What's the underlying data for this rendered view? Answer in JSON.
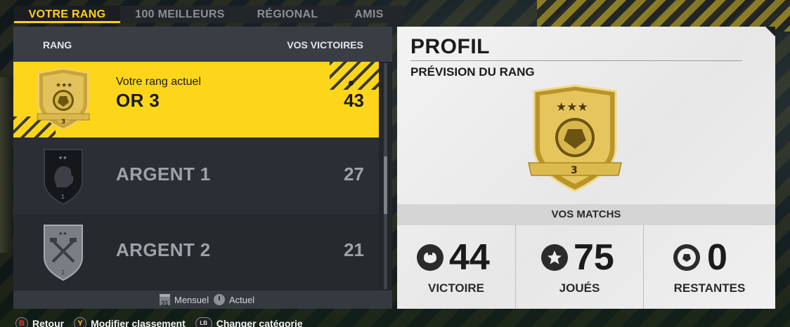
{
  "tabs": [
    {
      "label": "VOTRE RANG",
      "active": true
    },
    {
      "label": "100 MEILLEURS",
      "active": false
    },
    {
      "label": "RÉGIONAL",
      "active": false
    },
    {
      "label": "AMIS",
      "active": false
    }
  ],
  "rank_list": {
    "header_rank": "RANG",
    "header_wins": "VOS VICTOIRES",
    "rows": [
      {
        "subtitle": "Votre rang actuel",
        "name": "OR 3",
        "wins": "43",
        "badge_number": "3",
        "badge": "gold-rank-badge-icon",
        "current": true
      },
      {
        "subtitle": "",
        "name": "ARGENT 1",
        "wins": "27",
        "badge_number": "1",
        "badge": "dark-lion-badge-icon",
        "current": false
      },
      {
        "subtitle": "",
        "name": "ARGENT 2",
        "wins": "21",
        "badge_number": "2",
        "badge": "silver-hammer-badge-icon",
        "current": false
      }
    ],
    "footer": {
      "monthly": "Mensuel",
      "monthly_icon_text": "31",
      "current": "Actuel"
    }
  },
  "profile": {
    "title": "PROFIL",
    "subtitle": "PRÉVISION DU RANG",
    "badge_number": "3",
    "matches_title": "VOS MATCHS",
    "stats": [
      {
        "value": "44",
        "label": "VICTOIRE",
        "icon": "muscle-icon"
      },
      {
        "value": "75",
        "label": "JOUÉS",
        "icon": "star-icon"
      },
      {
        "value": "0",
        "label": "RESTANTES",
        "icon": "soccer-ball-icon"
      }
    ]
  },
  "hints": [
    {
      "button": "B",
      "label": "Retour"
    },
    {
      "button": "Y",
      "label": "Modifier classement"
    },
    {
      "button": "LB RB",
      "label": "Changer catégorie"
    }
  ],
  "colors": {
    "accent": "#fdd51b",
    "panel_dark": "#23262b",
    "profile_bg": "#ececec"
  }
}
